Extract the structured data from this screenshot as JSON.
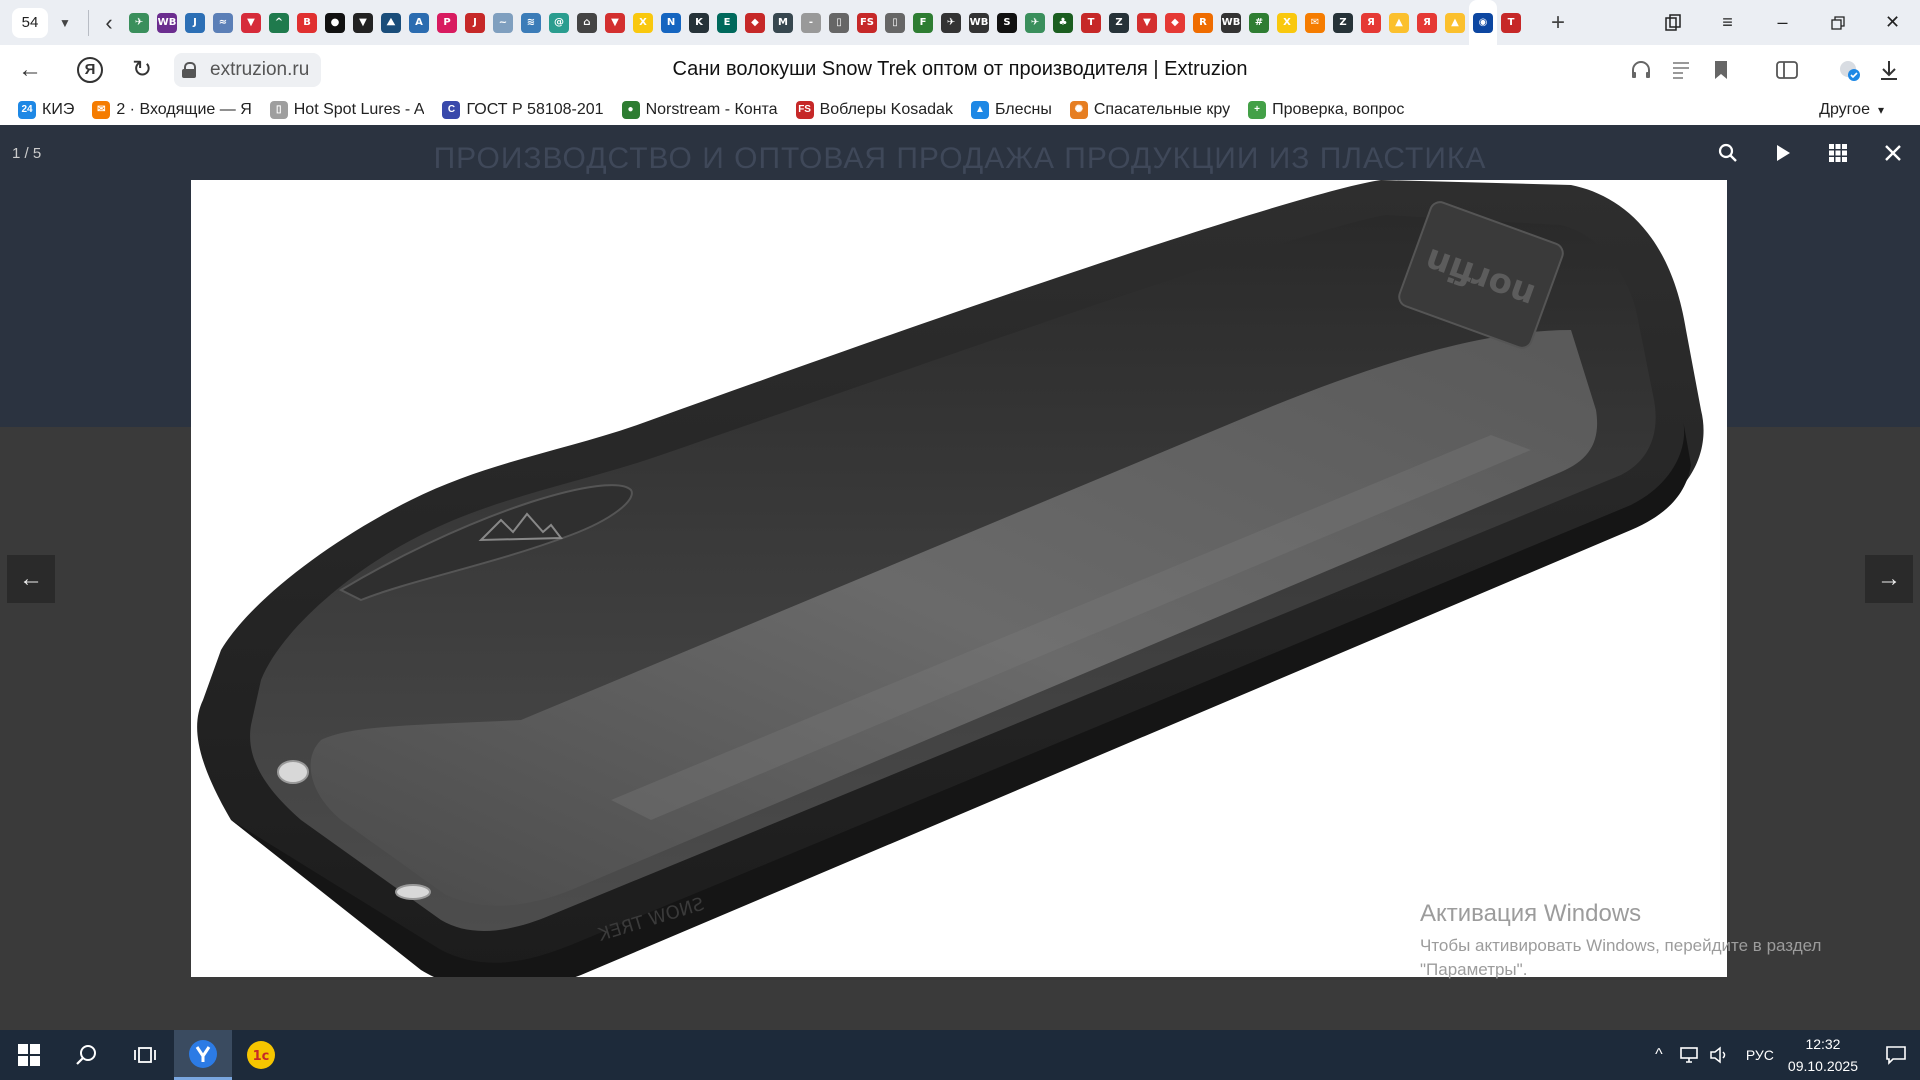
{
  "browser": {
    "tab_count": "54",
    "page_title": "Сани волокуши Snow Trek оптом от производителя | Extruzion",
    "url": "extruzion.ru",
    "tab_favicons": [
      {
        "name": "dart-icon",
        "color": "#3a8f5c",
        "glyph": "✈"
      },
      {
        "name": "wb-icon",
        "color": "#6b2d8f",
        "glyph": "WB"
      },
      {
        "name": "hook-icon",
        "color": "#2c6fb5",
        "glyph": "J"
      },
      {
        "name": "fish-icon",
        "color": "#5b7fb7",
        "glyph": "≈"
      },
      {
        "name": "shield-icon",
        "color": "#d62b3a",
        "glyph": "▼"
      },
      {
        "name": "bird-icon",
        "color": "#1f7a4d",
        "glyph": "^"
      },
      {
        "name": "b-icon",
        "color": "#e03030",
        "glyph": "B"
      },
      {
        "name": "disc-icon",
        "color": "#111111",
        "glyph": "●"
      },
      {
        "name": "badge-icon",
        "color": "#222222",
        "glyph": "▼"
      },
      {
        "name": "map-icon",
        "color": "#1a4d7a",
        "glyph": "⛰"
      },
      {
        "name": "arrow-icon",
        "color": "#2b6cb0",
        "glyph": "A"
      },
      {
        "name": "p-icon",
        "color": "#d81b60",
        "glyph": "P"
      },
      {
        "name": "j-icon",
        "color": "#c62828",
        "glyph": "J"
      },
      {
        "name": "wave-icon",
        "color": "#7f9fbf",
        "glyph": "~"
      },
      {
        "name": "ocean-icon",
        "color": "#3b7cb8",
        "glyph": "≋"
      },
      {
        "name": "spiral-icon",
        "color": "#2a9d8f",
        "glyph": "@"
      },
      {
        "name": "house-icon",
        "color": "#444444",
        "glyph": "⌂"
      },
      {
        "name": "shield-icon",
        "color": "#d32f2f",
        "glyph": "▼"
      },
      {
        "name": "x-icon",
        "color": "#f9c80e",
        "glyph": "X"
      },
      {
        "name": "n-icon",
        "color": "#1565c0",
        "glyph": "N"
      },
      {
        "name": "k-icon",
        "color": "#263238",
        "glyph": "K"
      },
      {
        "name": "e-icon",
        "color": "#00695c",
        "glyph": "E"
      },
      {
        "name": "fish-icon",
        "color": "#c62828",
        "glyph": "◆"
      },
      {
        "name": "m-icon",
        "color": "#37474f",
        "glyph": "M"
      },
      {
        "name": "dash-icon",
        "color": "#999999",
        "glyph": "-"
      },
      {
        "name": "doc-icon",
        "color": "#666666",
        "glyph": "▯"
      },
      {
        "name": "fs-icon",
        "color": "#c62828",
        "glyph": "FS"
      },
      {
        "name": "doc-icon",
        "color": "#666666",
        "glyph": "▯"
      },
      {
        "name": "f-icon",
        "color": "#2e7d32",
        "glyph": "F"
      },
      {
        "name": "plane-icon",
        "color": "#333333",
        "glyph": "✈"
      },
      {
        "name": "wb-icon",
        "color": "#333333",
        "glyph": "WB"
      },
      {
        "name": "s-icon",
        "color": "#111111",
        "glyph": "S"
      },
      {
        "name": "dart-icon",
        "color": "#3a8f5c",
        "glyph": "✈"
      },
      {
        "name": "forest-icon",
        "color": "#1b5e20",
        "glyph": "♣"
      },
      {
        "name": "eagle-icon",
        "color": "#c62828",
        "glyph": "T"
      },
      {
        "name": "z-icon",
        "color": "#263238",
        "glyph": "Z"
      },
      {
        "name": "shield-icon",
        "color": "#d32f2f",
        "glyph": "▼"
      },
      {
        "name": "fish-icon",
        "color": "#e53935",
        "glyph": "◆"
      },
      {
        "name": "r-icon",
        "color": "#ef6c00",
        "glyph": "R"
      },
      {
        "name": "wb-icon",
        "color": "#333333",
        "glyph": "WB"
      },
      {
        "name": "tag-icon",
        "color": "#2e7d32",
        "glyph": "#"
      },
      {
        "name": "x-icon",
        "color": "#f9c80e",
        "glyph": "X"
      },
      {
        "name": "mail-icon",
        "color": "#f57c00",
        "glyph": "✉"
      },
      {
        "name": "z-icon",
        "color": "#263238",
        "glyph": "Z"
      },
      {
        "name": "ya-icon",
        "color": "#e53935",
        "glyph": "Я"
      },
      {
        "name": "mountain-icon",
        "color": "#fbc02d",
        "glyph": "▲"
      },
      {
        "name": "ya-icon",
        "color": "#e53935",
        "glyph": "Я"
      },
      {
        "name": "mountain-icon",
        "color": "#fbc02d",
        "glyph": "▲"
      },
      {
        "name": "globe-icon",
        "color": "#0d47a1",
        "glyph": "◉"
      },
      {
        "name": "eagle-icon",
        "color": "#c62828",
        "glyph": "T"
      }
    ],
    "bookmarks": [
      {
        "label": "КИЭ",
        "icon": "mail-badge-icon",
        "color": "#1e88e5",
        "glyph": "24"
      },
      {
        "label": "2 · Входящие — Я",
        "icon": "mail-icon",
        "color": "#f57c00",
        "glyph": "✉"
      },
      {
        "label": "Hot Spot Lures - A",
        "icon": "document-icon",
        "color": "#9e9e9e",
        "glyph": "▯"
      },
      {
        "label": "ГОСТ Р 58108-201",
        "icon": "gost-icon",
        "color": "#3949ab",
        "glyph": "C"
      },
      {
        "label": "Norstream - Конта",
        "icon": "norstream-icon",
        "color": "#2e7d32",
        "glyph": "●"
      },
      {
        "label": "Воблеры Kosadak",
        "icon": "fs-icon",
        "color": "#c62828",
        "glyph": "FS"
      },
      {
        "label": "Блесны",
        "icon": "drive-icon",
        "color": "#1e88e5",
        "glyph": "▲"
      },
      {
        "label": "Спасательные кру",
        "icon": "lifebuoy-icon",
        "color": "#e67e22",
        "glyph": "✺"
      },
      {
        "label": "Проверка, вопрос",
        "icon": "plus-icon",
        "color": "#43a047",
        "glyph": "+"
      }
    ],
    "bookmarks_other": "Другое"
  },
  "page": {
    "header_title": "ПРОИЗВОДСТВО И ОПТОВАЯ ПРОДАЖА ПРОДУКЦИИ ИЗ ПЛАСТИКА"
  },
  "lightbox": {
    "counter": "1 / 5",
    "image_brand_text": "SNOW TREK",
    "image_logo_text": "norfin"
  },
  "watermark": {
    "title": "Активация Windows",
    "line1": "Чтобы активировать Windows, перейдите в раздел",
    "line2": "\"Параметры\"."
  },
  "taskbar": {
    "lang": "РУС",
    "time": "12:32",
    "date": "09.10.2025"
  }
}
